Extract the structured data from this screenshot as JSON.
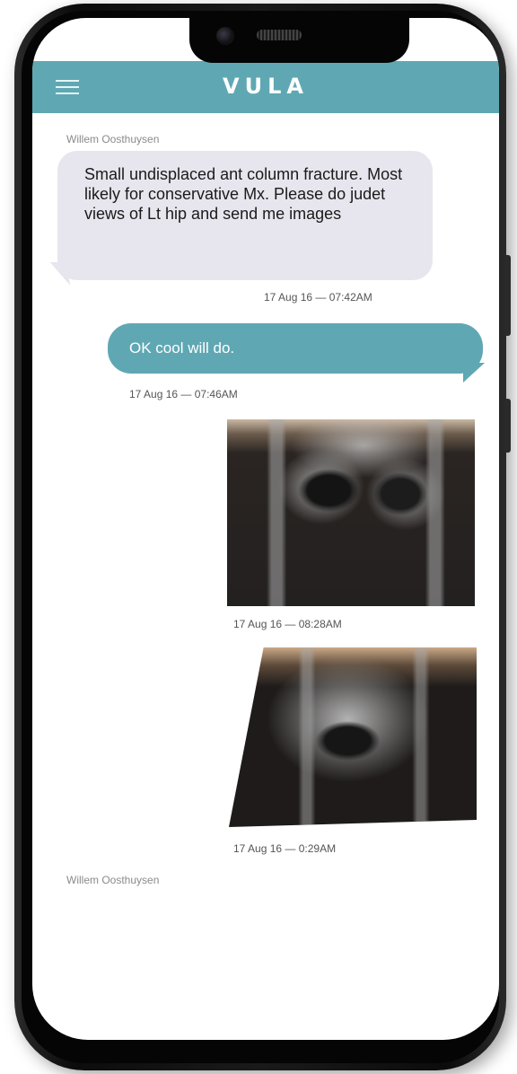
{
  "app": {
    "title": "VULA"
  },
  "messages": [
    {
      "sender": "Willem Oosthuysen",
      "text": "Small undisplaced ant column fracture. Most likely for conservative Mx. Please do judet views of Lt hip and send me images",
      "time": "17 Aug 16 — 07:42AM"
    },
    {
      "text": "OK cool will do.",
      "time": "17 Aug 16 — 07:46AM"
    },
    {
      "image": "pelvis-xray",
      "time": "17 Aug 16 — 08:28AM"
    },
    {
      "image": "pelvis-xray",
      "time": "17 Aug 16 — 0:29AM"
    }
  ],
  "trailing_sender": "Willem Oosthuysen",
  "colors": {
    "accent": "#5fa8b3",
    "incoming_bubble": "#e7e6ee",
    "background": "#ffffff"
  },
  "icons": {
    "menu": "hamburger-menu-icon"
  }
}
